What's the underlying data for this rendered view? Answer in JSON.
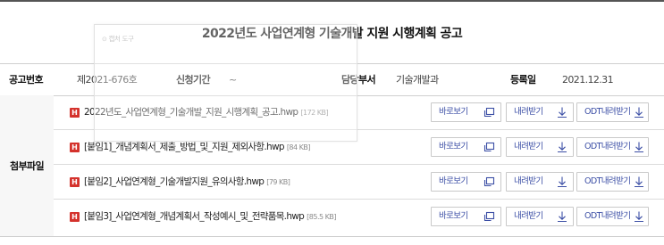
{
  "announcement": {
    "title": "2022년도 사업연계형 기술개발 지원 시행계획 공고"
  },
  "meta": {
    "number_label": "공고번호",
    "number_value": "제2021-676호",
    "period_label": "신청기간",
    "period_value": "~",
    "department_label": "담당부서",
    "department_value": "기술개발과",
    "date_label": "등록일",
    "date_value": "2021.12.31"
  },
  "attachments": {
    "label": "첨부파일",
    "files": [
      {
        "name": "2022년도_사업연계형_기술개발_지원_시행계획_공고.hwp",
        "size": "[172 KB]"
      },
      {
        "name": "[붙임1]_개념계획서_제출_방법_및_지원_제외사항.hwp",
        "size": "[84 KB]"
      },
      {
        "name": "[붙임2]_사업연계형_기술개발지원_유의사항.hwp",
        "size": "[79 KB]"
      },
      {
        "name": "[붙임3]_사업연계형_개념계획서_작성예시_및_전략품목.hwp",
        "size": "[85.5 KB]"
      }
    ],
    "file_badge": "H",
    "buttons": {
      "view_label": "바로보기",
      "download_label": "내려받기",
      "odt_label": "ODT내려받기"
    },
    "icons": {
      "view": "window-icon",
      "download": "download-arrow-icon"
    }
  },
  "overlay": {
    "label": "캡처 도구",
    "icon": "capture-icon"
  }
}
